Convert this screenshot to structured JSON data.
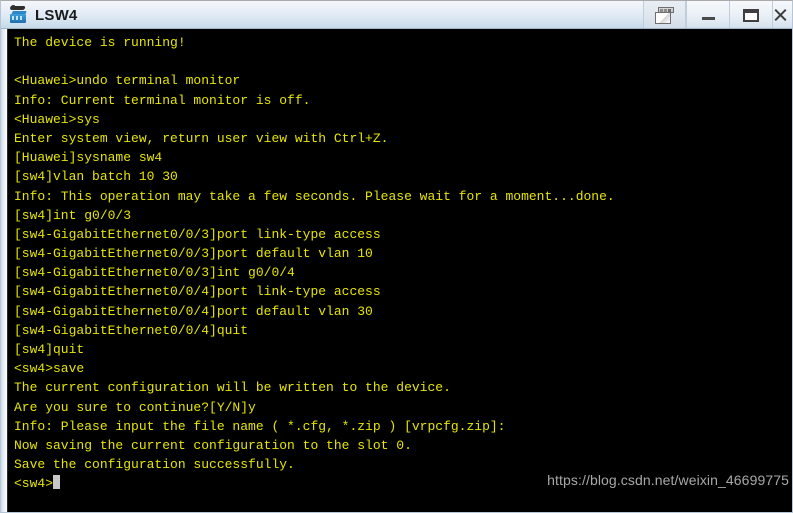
{
  "window": {
    "title": "LSW4",
    "icon": "switch-device-icon",
    "controls": [
      {
        "name": "restore-button",
        "glyph": "restore-icon",
        "label": "Restore"
      },
      {
        "name": "minimize-button",
        "glyph": "minimize-icon",
        "label": "Minimize"
      },
      {
        "name": "maximize-button",
        "glyph": "maximize-icon",
        "label": "Maximize"
      },
      {
        "name": "close-button",
        "glyph": "close-icon",
        "label": "Close"
      }
    ]
  },
  "terminal": {
    "foreground_color": "#e5e500",
    "background_color": "#000000",
    "prompt_current": "<sw4>",
    "lines": [
      "The device is running!",
      "",
      "<Huawei>undo terminal monitor",
      "Info: Current terminal monitor is off.",
      "<Huawei>sys",
      "Enter system view, return user view with Ctrl+Z.",
      "[Huawei]sysname sw4",
      "[sw4]vlan batch 10 30",
      "Info: This operation may take a few seconds. Please wait for a moment...done.",
      "[sw4]int g0/0/3",
      "[sw4-GigabitEthernet0/0/3]port link-type access",
      "[sw4-GigabitEthernet0/0/3]port default vlan 10",
      "[sw4-GigabitEthernet0/0/3]int g0/0/4",
      "[sw4-GigabitEthernet0/0/4]port link-type access",
      "[sw4-GigabitEthernet0/0/4]port default vlan 30",
      "[sw4-GigabitEthernet0/0/4]quit",
      "[sw4]quit",
      "<sw4>save",
      "The current configuration will be written to the device.",
      "Are you sure to continue?[Y/N]y",
      "Info: Please input the file name ( *.cfg, *.zip ) [vrpcfg.zip]:",
      "Now saving the current configuration to the slot 0.",
      "Save the configuration successfully."
    ]
  },
  "watermark": {
    "text": "https://blog.csdn.net/weixin_46699775",
    "color": "#a8a8a8"
  }
}
